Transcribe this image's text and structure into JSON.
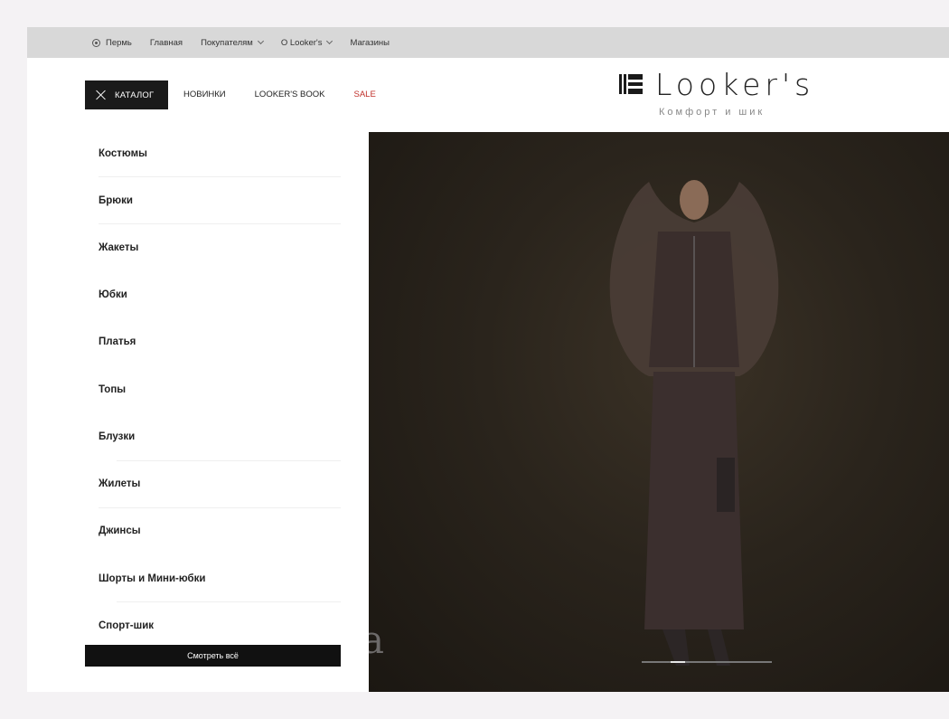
{
  "topbar": {
    "city": "Пермь",
    "links": [
      {
        "label": "Главная",
        "has_dropdown": false
      },
      {
        "label": "Покупателям",
        "has_dropdown": true
      },
      {
        "label": "O Looker's",
        "has_dropdown": true
      },
      {
        "label": "Магазины",
        "has_dropdown": false
      }
    ]
  },
  "header": {
    "catalog_label": "КАТАЛОГ",
    "nav": [
      "НОВИНКИ",
      "LOOKER'S BOOK",
      "SALE"
    ],
    "logo_text": "Looker's",
    "logo_tagline": "Комфорт и шик"
  },
  "menu": {
    "items": [
      "Костюмы",
      "Брюки",
      "Жакеты",
      "Юбки",
      "Платья",
      "Топы",
      "Блузки",
      "Жилеты",
      "Джинсы",
      "Шорты и Мини-юбки",
      "Спорт-шик"
    ],
    "view_all": "Смотреть всё"
  },
  "hero": {
    "letter": "a",
    "slides_total": 9,
    "active_slide": 3
  },
  "colors": {
    "accent_sale": "#c0312b",
    "dark": "#1a1a1a",
    "topbar_bg": "#d8d8d8"
  }
}
